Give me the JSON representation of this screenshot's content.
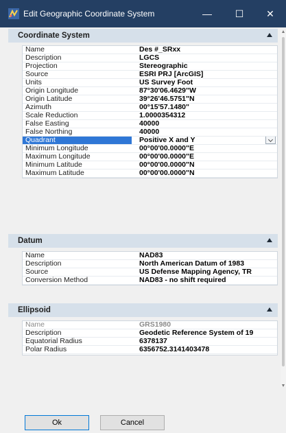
{
  "window": {
    "title": "Edit Geographic Coordinate System",
    "icon": "map-app-icon",
    "controls": {
      "minimize": "—",
      "maximize": "☐",
      "close": "✕"
    }
  },
  "colors": {
    "titlebar": "#243f63",
    "section_header": "#d6e0ea",
    "selection": "#2f77d6"
  },
  "sections": {
    "coordinate_system": {
      "title": "Coordinate System",
      "rows": [
        {
          "name": "Name",
          "value": "Des #_SRxx"
        },
        {
          "name": "Description",
          "value": "LGCS"
        },
        {
          "name": "Projection",
          "value": "Stereographic"
        },
        {
          "name": "Source",
          "value": "ESRI PRJ [ArcGIS]"
        },
        {
          "name": "Units",
          "value": "US Survey Foot"
        },
        {
          "name": "Origin Longitude",
          "value": "87°30'06.4629\"W"
        },
        {
          "name": "Origin Latitude",
          "value": "39°26'46.5751\"N"
        },
        {
          "name": "Azimuth",
          "value": "00°15'57.1480\""
        },
        {
          "name": "Scale Reduction",
          "value": "1.0000354312"
        },
        {
          "name": "False Easting",
          "value": "40000"
        },
        {
          "name": "False Northing",
          "value": "40000"
        },
        {
          "name": "Quadrant",
          "value": "Positive X and Y"
        },
        {
          "name": "Minimum Longitude",
          "value": "00°00'00.0000\"E"
        },
        {
          "name": "Maximum Longitude",
          "value": "00°00'00.0000\"E"
        },
        {
          "name": "Minimum Latitude",
          "value": "00°00'00.0000\"N"
        },
        {
          "name": "Maximum Latitude",
          "value": "00°00'00.0000\"N"
        }
      ]
    },
    "datum": {
      "title": "Datum",
      "rows": [
        {
          "name": "Name",
          "value": "NAD83"
        },
        {
          "name": "Description",
          "value": "North American Datum of 1983"
        },
        {
          "name": "Source",
          "value": "US Defense Mapping Agency, TR"
        },
        {
          "name": "Conversion Method",
          "value": "NAD83 - no shift required"
        }
      ]
    },
    "ellipsoid": {
      "title": "Ellipsoid",
      "rows": [
        {
          "name": "Name",
          "value": "GRS1980"
        },
        {
          "name": "Description",
          "value": "Geodetic Reference System of 19"
        },
        {
          "name": "Equatorial Radius",
          "value": "6378137"
        },
        {
          "name": "Polar Radius",
          "value": "6356752.3141403478"
        }
      ]
    }
  },
  "buttons": {
    "ok": "Ok",
    "cancel": "Cancel"
  }
}
